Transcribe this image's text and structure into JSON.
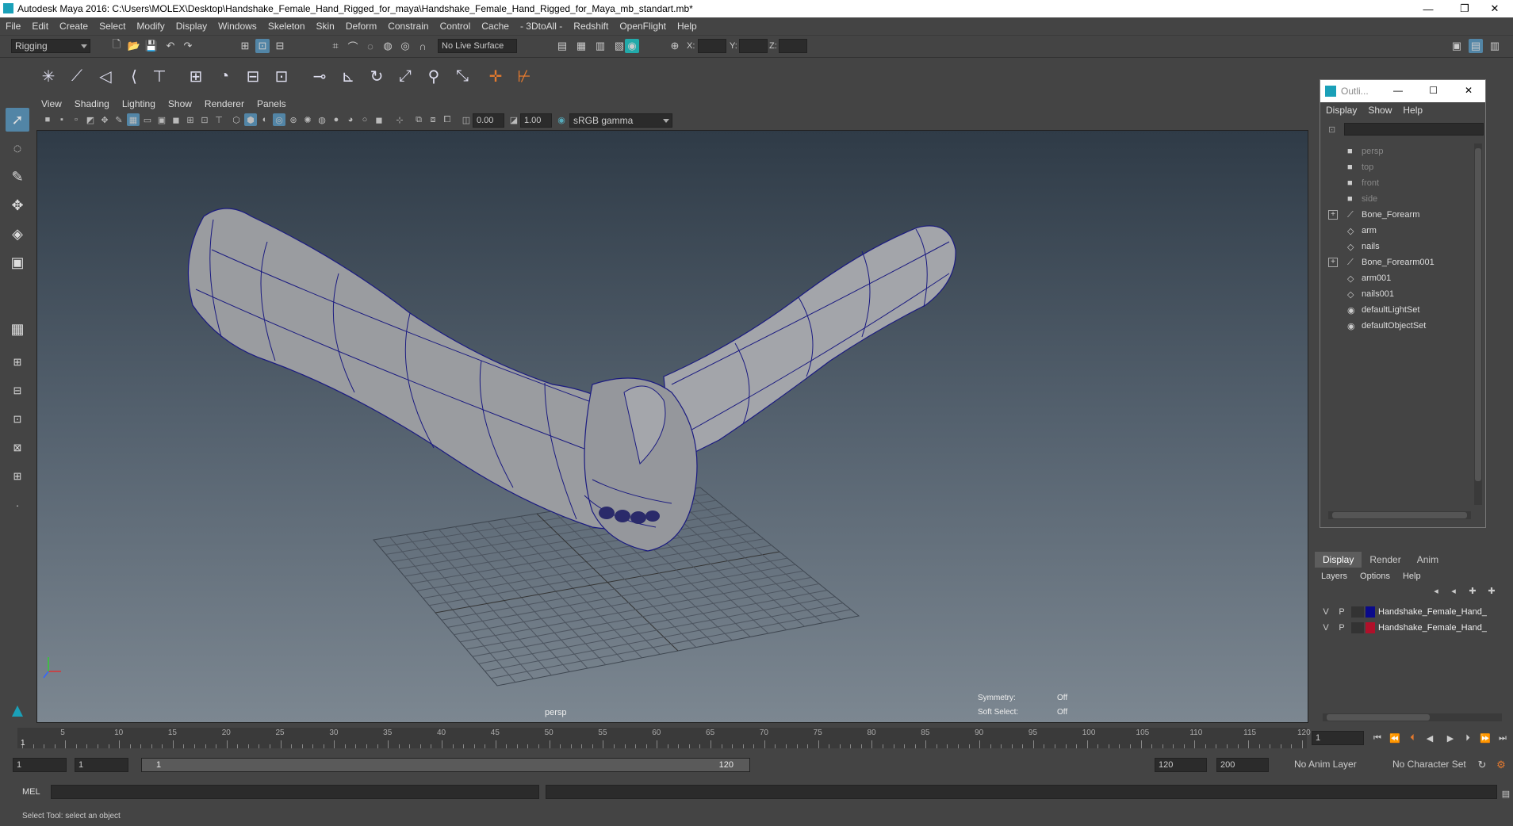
{
  "window": {
    "title": "Autodesk Maya 2016: C:\\Users\\MOLEX\\Desktop\\Handshake_Female_Hand_Rigged_for_maya\\Handshake_Female_Hand_Rigged_for_Maya_mb_standart.mb*",
    "minimize": "—",
    "restore": "❐",
    "close": "✕"
  },
  "menubar": [
    "File",
    "Edit",
    "Create",
    "Select",
    "Modify",
    "Display",
    "Windows",
    "Skeleton",
    "Skin",
    "Deform",
    "Constrain",
    "Control",
    "Cache",
    "- 3DtoAll -",
    "Redshift",
    "OpenFlight",
    "Help"
  ],
  "statusline": {
    "mode": "Rigging",
    "live_surface": "No Live Surface",
    "x_label": "X:",
    "y_label": "Y:",
    "z_label": "Z:"
  },
  "panel": {
    "menu": [
      "View",
      "Shading",
      "Lighting",
      "Show",
      "Renderer",
      "Panels"
    ],
    "exposure": "0.00",
    "gamma": "1.00",
    "color_space": "sRGB gamma"
  },
  "viewport": {
    "camera_label": "persp",
    "symmetry_label": "Symmetry:",
    "symmetry_value": "Off",
    "soft_select_label": "Soft Select:",
    "soft_select_value": "Off"
  },
  "outliner": {
    "title": "Outli...",
    "menu": [
      "Display",
      "Show",
      "Help"
    ],
    "items": [
      {
        "label": "persp",
        "icon": "camera-icon",
        "dim": true,
        "expand": false
      },
      {
        "label": "top",
        "icon": "camera-icon",
        "dim": true,
        "expand": false
      },
      {
        "label": "front",
        "icon": "camera-icon",
        "dim": true,
        "expand": false
      },
      {
        "label": "side",
        "icon": "camera-icon",
        "dim": true,
        "expand": false
      },
      {
        "label": "Bone_Forearm",
        "icon": "joint-icon",
        "dim": false,
        "expand": true
      },
      {
        "label": "arm",
        "icon": "mesh-icon",
        "dim": false,
        "expand": false
      },
      {
        "label": "nails",
        "icon": "mesh-icon",
        "dim": false,
        "expand": false
      },
      {
        "label": "Bone_Forearm001",
        "icon": "joint-icon",
        "dim": false,
        "expand": true
      },
      {
        "label": "arm001",
        "icon": "mesh-icon",
        "dim": false,
        "expand": false
      },
      {
        "label": "nails001",
        "icon": "mesh-icon",
        "dim": false,
        "expand": false
      },
      {
        "label": "defaultLightSet",
        "icon": "set-icon",
        "dim": false,
        "expand": false
      },
      {
        "label": "defaultObjectSet",
        "icon": "set-icon",
        "dim": false,
        "expand": false
      }
    ]
  },
  "layers": {
    "tabs": [
      "Display",
      "Render",
      "Anim"
    ],
    "menu": [
      "Layers",
      "Options",
      "Help"
    ],
    "rows": [
      {
        "v": "V",
        "p": "P",
        "color": "#0a0a8a",
        "name": "Handshake_Female_Hand_"
      },
      {
        "v": "V",
        "p": "P",
        "color": "#b0102a",
        "name": "Handshake_Female_Hand_"
      }
    ]
  },
  "timeline": {
    "ticks": [
      "5",
      "10",
      "15",
      "20",
      "25",
      "30",
      "35",
      "40",
      "45",
      "50",
      "55",
      "60",
      "65",
      "70",
      "75",
      "80",
      "85",
      "90",
      "95",
      "100",
      "105",
      "110",
      "115",
      "120"
    ],
    "current_frame_marker": "1",
    "current_frame_field": "1"
  },
  "range": {
    "start": "1",
    "playback_start": "1",
    "slider_start": "1",
    "slider_end": "120",
    "playback_end": "120",
    "end": "200",
    "anim_layer": "No Anim Layer",
    "character_set": "No Character Set"
  },
  "command": {
    "language": "MEL"
  },
  "helpline": {
    "text": "Select Tool: select an object"
  }
}
